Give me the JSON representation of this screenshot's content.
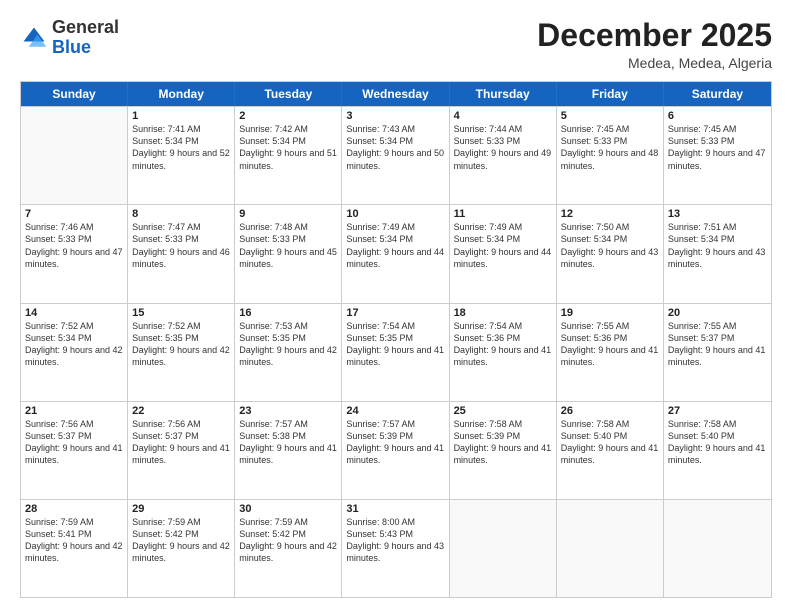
{
  "header": {
    "logo_general": "General",
    "logo_blue": "Blue",
    "month_title": "December 2025",
    "location": "Medea, Medea, Algeria"
  },
  "weekdays": [
    "Sunday",
    "Monday",
    "Tuesday",
    "Wednesday",
    "Thursday",
    "Friday",
    "Saturday"
  ],
  "rows": [
    [
      {
        "day": "",
        "sunrise": "",
        "sunset": "",
        "daylight": "",
        "empty": true
      },
      {
        "day": "1",
        "sunrise": "Sunrise: 7:41 AM",
        "sunset": "Sunset: 5:34 PM",
        "daylight": "Daylight: 9 hours and 52 minutes."
      },
      {
        "day": "2",
        "sunrise": "Sunrise: 7:42 AM",
        "sunset": "Sunset: 5:34 PM",
        "daylight": "Daylight: 9 hours and 51 minutes."
      },
      {
        "day": "3",
        "sunrise": "Sunrise: 7:43 AM",
        "sunset": "Sunset: 5:34 PM",
        "daylight": "Daylight: 9 hours and 50 minutes."
      },
      {
        "day": "4",
        "sunrise": "Sunrise: 7:44 AM",
        "sunset": "Sunset: 5:33 PM",
        "daylight": "Daylight: 9 hours and 49 minutes."
      },
      {
        "day": "5",
        "sunrise": "Sunrise: 7:45 AM",
        "sunset": "Sunset: 5:33 PM",
        "daylight": "Daylight: 9 hours and 48 minutes."
      },
      {
        "day": "6",
        "sunrise": "Sunrise: 7:45 AM",
        "sunset": "Sunset: 5:33 PM",
        "daylight": "Daylight: 9 hours and 47 minutes."
      }
    ],
    [
      {
        "day": "7",
        "sunrise": "Sunrise: 7:46 AM",
        "sunset": "Sunset: 5:33 PM",
        "daylight": "Daylight: 9 hours and 47 minutes."
      },
      {
        "day": "8",
        "sunrise": "Sunrise: 7:47 AM",
        "sunset": "Sunset: 5:33 PM",
        "daylight": "Daylight: 9 hours and 46 minutes."
      },
      {
        "day": "9",
        "sunrise": "Sunrise: 7:48 AM",
        "sunset": "Sunset: 5:33 PM",
        "daylight": "Daylight: 9 hours and 45 minutes."
      },
      {
        "day": "10",
        "sunrise": "Sunrise: 7:49 AM",
        "sunset": "Sunset: 5:34 PM",
        "daylight": "Daylight: 9 hours and 44 minutes."
      },
      {
        "day": "11",
        "sunrise": "Sunrise: 7:49 AM",
        "sunset": "Sunset: 5:34 PM",
        "daylight": "Daylight: 9 hours and 44 minutes."
      },
      {
        "day": "12",
        "sunrise": "Sunrise: 7:50 AM",
        "sunset": "Sunset: 5:34 PM",
        "daylight": "Daylight: 9 hours and 43 minutes."
      },
      {
        "day": "13",
        "sunrise": "Sunrise: 7:51 AM",
        "sunset": "Sunset: 5:34 PM",
        "daylight": "Daylight: 9 hours and 43 minutes."
      }
    ],
    [
      {
        "day": "14",
        "sunrise": "Sunrise: 7:52 AM",
        "sunset": "Sunset: 5:34 PM",
        "daylight": "Daylight: 9 hours and 42 minutes."
      },
      {
        "day": "15",
        "sunrise": "Sunrise: 7:52 AM",
        "sunset": "Sunset: 5:35 PM",
        "daylight": "Daylight: 9 hours and 42 minutes."
      },
      {
        "day": "16",
        "sunrise": "Sunrise: 7:53 AM",
        "sunset": "Sunset: 5:35 PM",
        "daylight": "Daylight: 9 hours and 42 minutes."
      },
      {
        "day": "17",
        "sunrise": "Sunrise: 7:54 AM",
        "sunset": "Sunset: 5:35 PM",
        "daylight": "Daylight: 9 hours and 41 minutes."
      },
      {
        "day": "18",
        "sunrise": "Sunrise: 7:54 AM",
        "sunset": "Sunset: 5:36 PM",
        "daylight": "Daylight: 9 hours and 41 minutes."
      },
      {
        "day": "19",
        "sunrise": "Sunrise: 7:55 AM",
        "sunset": "Sunset: 5:36 PM",
        "daylight": "Daylight: 9 hours and 41 minutes."
      },
      {
        "day": "20",
        "sunrise": "Sunrise: 7:55 AM",
        "sunset": "Sunset: 5:37 PM",
        "daylight": "Daylight: 9 hours and 41 minutes."
      }
    ],
    [
      {
        "day": "21",
        "sunrise": "Sunrise: 7:56 AM",
        "sunset": "Sunset: 5:37 PM",
        "daylight": "Daylight: 9 hours and 41 minutes."
      },
      {
        "day": "22",
        "sunrise": "Sunrise: 7:56 AM",
        "sunset": "Sunset: 5:37 PM",
        "daylight": "Daylight: 9 hours and 41 minutes."
      },
      {
        "day": "23",
        "sunrise": "Sunrise: 7:57 AM",
        "sunset": "Sunset: 5:38 PM",
        "daylight": "Daylight: 9 hours and 41 minutes."
      },
      {
        "day": "24",
        "sunrise": "Sunrise: 7:57 AM",
        "sunset": "Sunset: 5:39 PM",
        "daylight": "Daylight: 9 hours and 41 minutes."
      },
      {
        "day": "25",
        "sunrise": "Sunrise: 7:58 AM",
        "sunset": "Sunset: 5:39 PM",
        "daylight": "Daylight: 9 hours and 41 minutes."
      },
      {
        "day": "26",
        "sunrise": "Sunrise: 7:58 AM",
        "sunset": "Sunset: 5:40 PM",
        "daylight": "Daylight: 9 hours and 41 minutes."
      },
      {
        "day": "27",
        "sunrise": "Sunrise: 7:58 AM",
        "sunset": "Sunset: 5:40 PM",
        "daylight": "Daylight: 9 hours and 41 minutes."
      }
    ],
    [
      {
        "day": "28",
        "sunrise": "Sunrise: 7:59 AM",
        "sunset": "Sunset: 5:41 PM",
        "daylight": "Daylight: 9 hours and 42 minutes."
      },
      {
        "day": "29",
        "sunrise": "Sunrise: 7:59 AM",
        "sunset": "Sunset: 5:42 PM",
        "daylight": "Daylight: 9 hours and 42 minutes."
      },
      {
        "day": "30",
        "sunrise": "Sunrise: 7:59 AM",
        "sunset": "Sunset: 5:42 PM",
        "daylight": "Daylight: 9 hours and 42 minutes."
      },
      {
        "day": "31",
        "sunrise": "Sunrise: 8:00 AM",
        "sunset": "Sunset: 5:43 PM",
        "daylight": "Daylight: 9 hours and 43 minutes."
      },
      {
        "day": "",
        "sunrise": "",
        "sunset": "",
        "daylight": "",
        "empty": true
      },
      {
        "day": "",
        "sunrise": "",
        "sunset": "",
        "daylight": "",
        "empty": true
      },
      {
        "day": "",
        "sunrise": "",
        "sunset": "",
        "daylight": "",
        "empty": true
      }
    ]
  ]
}
